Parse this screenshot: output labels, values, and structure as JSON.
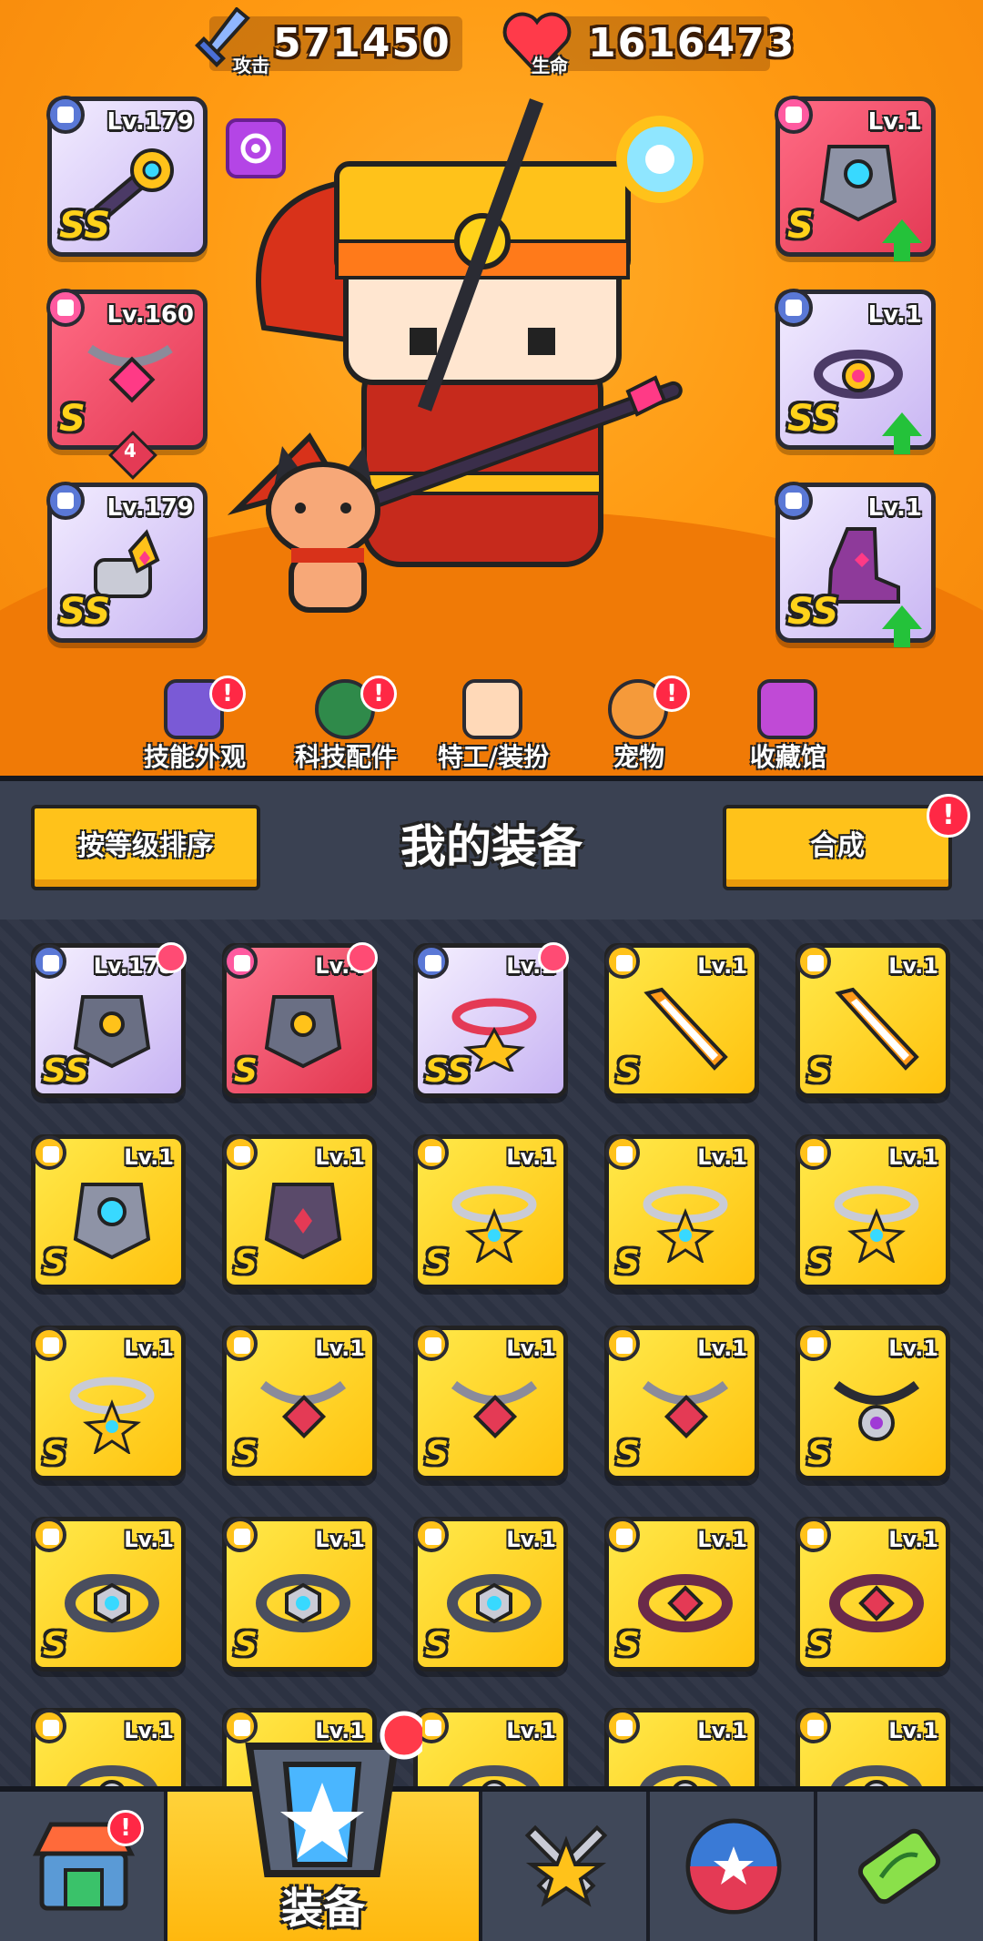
{
  "stats": {
    "attack_value": "571450",
    "attack_label": "攻击",
    "hp_value": "1616473",
    "hp_label": "生命"
  },
  "equipped_left": [
    {
      "level": "Lv.179",
      "rank": "SS",
      "slot": "weapon",
      "icon": "sword-gear-icon"
    },
    {
      "level": "Lv.160",
      "rank": "S",
      "slot": "necklace",
      "icon": "chain-necklace-icon",
      "star_count": "4"
    },
    {
      "level": "Lv.179",
      "rank": "SS",
      "slot": "gloves",
      "icon": "gauntlet-icon"
    }
  ],
  "equipped_right": [
    {
      "level": "Lv.1",
      "rank": "S",
      "slot": "armor",
      "icon": "mech-armor-icon",
      "upgrade": true
    },
    {
      "level": "Lv.1",
      "rank": "SS",
      "slot": "belt",
      "icon": "belt-icon",
      "upgrade": true
    },
    {
      "level": "Lv.1",
      "rank": "SS",
      "slot": "boots",
      "icon": "boots-icon",
      "upgrade": true
    }
  ],
  "menu": [
    {
      "label": "技能外观",
      "icon": "skill-skin-icon",
      "alert": "!"
    },
    {
      "label": "科技配件",
      "icon": "tech-part-icon",
      "alert": "!"
    },
    {
      "label": "特工/装扮",
      "icon": "agent-outfit-icon",
      "alert": ""
    },
    {
      "label": "宠物",
      "icon": "pet-icon",
      "alert": "!"
    },
    {
      "label": "收藏馆",
      "icon": "collection-icon",
      "alert": ""
    }
  ],
  "panel": {
    "sort_button": "按等级排序",
    "title": "我的装备",
    "merge_button": "合成",
    "merge_alert": "!"
  },
  "inventory": [
    {
      "level": "Lv.178",
      "rank": "SS",
      "tier": "purple",
      "icon": "armor-icon"
    },
    {
      "level": "Lv.4",
      "rank": "S",
      "tier": "red",
      "icon": "armor-icon"
    },
    {
      "level": "Lv.1",
      "rank": "SS",
      "tier": "purple",
      "icon": "ring-necklace-icon"
    },
    {
      "level": "Lv.1",
      "rank": "S",
      "tier": "gold",
      "icon": "sword-icon"
    },
    {
      "level": "Lv.1",
      "rank": "S",
      "tier": "gold",
      "icon": "sword-icon"
    },
    {
      "level": "Lv.1",
      "rank": "S",
      "tier": "gold",
      "icon": "mech-armor-icon"
    },
    {
      "level": "Lv.1",
      "rank": "S",
      "tier": "gold",
      "icon": "dark-armor-icon"
    },
    {
      "level": "Lv.1",
      "rank": "S",
      "tier": "gold",
      "icon": "star-necklace-icon"
    },
    {
      "level": "Lv.1",
      "rank": "S",
      "tier": "gold",
      "icon": "star-necklace-icon"
    },
    {
      "level": "Lv.1",
      "rank": "S",
      "tier": "gold",
      "icon": "star-necklace-icon"
    },
    {
      "level": "Lv.1",
      "rank": "S",
      "tier": "gold",
      "icon": "star-necklace-icon"
    },
    {
      "level": "Lv.1",
      "rank": "S",
      "tier": "gold",
      "icon": "chain-necklace-icon"
    },
    {
      "level": "Lv.1",
      "rank": "S",
      "tier": "gold",
      "icon": "chain-necklace-icon"
    },
    {
      "level": "Lv.1",
      "rank": "S",
      "tier": "gold",
      "icon": "chain-necklace-icon"
    },
    {
      "level": "Lv.1",
      "rank": "S",
      "tier": "gold",
      "icon": "dark-necklace-icon"
    },
    {
      "level": "Lv.1",
      "rank": "S",
      "tier": "gold",
      "icon": "hex-belt-icon"
    },
    {
      "level": "Lv.1",
      "rank": "S",
      "tier": "gold",
      "icon": "hex-belt-icon"
    },
    {
      "level": "Lv.1",
      "rank": "S",
      "tier": "gold",
      "icon": "hex-belt-icon"
    },
    {
      "level": "Lv.1",
      "rank": "S",
      "tier": "gold",
      "icon": "ruby-belt-icon"
    },
    {
      "level": "Lv.1",
      "rank": "S",
      "tier": "gold",
      "icon": "ruby-belt-icon"
    },
    {
      "level": "Lv.1",
      "rank": "S",
      "tier": "gold",
      "icon": "belt-icon"
    },
    {
      "level": "Lv.1",
      "rank": "S",
      "tier": "gold",
      "icon": "belt-icon"
    },
    {
      "level": "Lv.1",
      "rank": "S",
      "tier": "gold",
      "icon": "belt-icon"
    },
    {
      "level": "Lv.1",
      "rank": "S",
      "tier": "gold",
      "icon": "belt-icon"
    },
    {
      "level": "Lv.1",
      "rank": "S",
      "tier": "gold",
      "icon": "belt-icon"
    }
  ],
  "nav": [
    {
      "label": "",
      "icon": "shop-icon",
      "alert": "!"
    },
    {
      "label": "装备",
      "icon": "equipment-icon",
      "active": true
    },
    {
      "label": "",
      "icon": "battle-icon"
    },
    {
      "label": "",
      "icon": "orb-icon"
    },
    {
      "label": "",
      "icon": "dna-capsule-icon"
    }
  ],
  "colors": {
    "hero_bg": "#ff9a12",
    "panel_bg": "#2c3242",
    "gold_tier": "#ffc20e",
    "purple_tier": "#c7b3f3",
    "red_tier": "#e2374f",
    "alert": "#ff2845",
    "upgrade": "#24c23a"
  }
}
